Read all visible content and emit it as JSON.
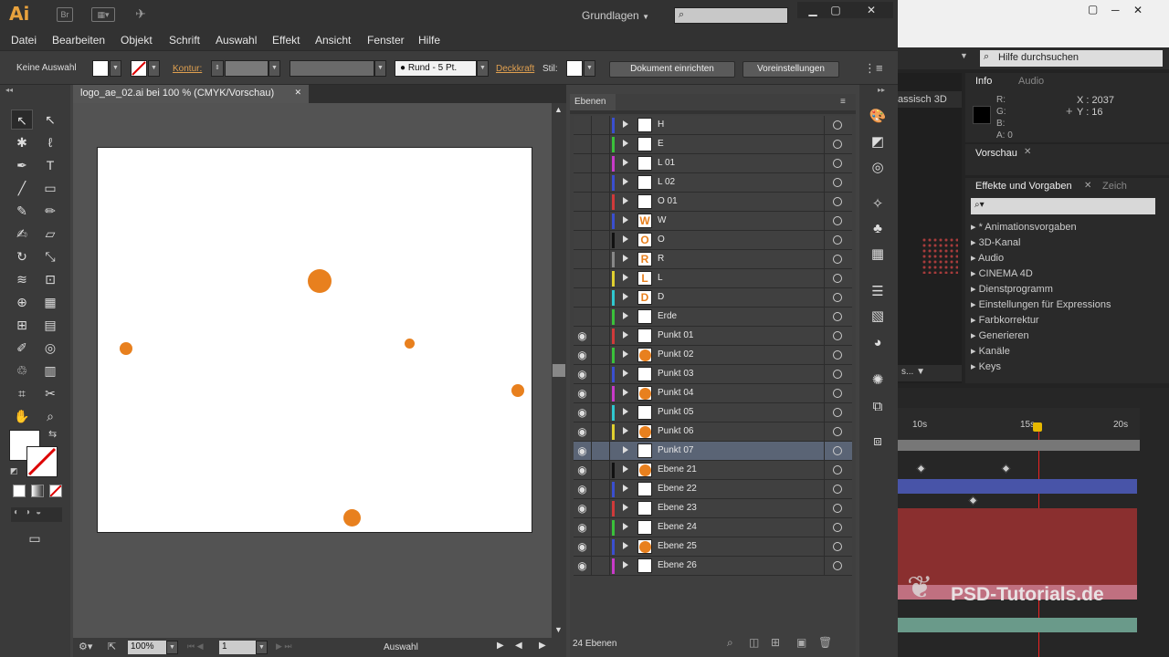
{
  "app": {
    "logo": "Ai",
    "workspace": "Grundlagen"
  },
  "menu": [
    "Datei",
    "Bearbeiten",
    "Objekt",
    "Schrift",
    "Auswahl",
    "Effekt",
    "Ansicht",
    "Fenster",
    "Hilfe"
  ],
  "control": {
    "selection": "Keine Auswahl",
    "kontur_label": "Kontur:",
    "brush": "Rund - 5 Pt.",
    "deckkraft_label": "Deckkraft",
    "stil_label": "Stil:",
    "doc_setup": "Dokument einrichten",
    "preferences": "Voreinstellungen"
  },
  "document": {
    "tab_title": "logo_ae_02.ai bei 100 % (CMYK/Vorschau)"
  },
  "status": {
    "zoom": "100%",
    "artboard": "1",
    "tool": "Auswahl"
  },
  "layers_panel": {
    "title": "Ebenen",
    "count": "24 Ebenen",
    "layers": [
      {
        "name": "H",
        "color": "#3a4fd0",
        "eye": false,
        "thumb": ""
      },
      {
        "name": "E",
        "color": "#3ac03a",
        "eye": false,
        "thumb": ""
      },
      {
        "name": "L 01",
        "color": "#c83ac8",
        "eye": false,
        "thumb": ""
      },
      {
        "name": "L 02",
        "color": "#3a4fd0",
        "eye": false,
        "thumb": ""
      },
      {
        "name": "O 01",
        "color": "#d03a3a",
        "eye": false,
        "thumb": ""
      },
      {
        "name": "W",
        "color": "#3a4fd0",
        "eye": false,
        "thumb": "W"
      },
      {
        "name": "O",
        "color": "#111111",
        "eye": false,
        "thumb": "O"
      },
      {
        "name": "R",
        "color": "#888888",
        "eye": false,
        "thumb": "R"
      },
      {
        "name": "L",
        "color": "#e0d030",
        "eye": false,
        "thumb": "L"
      },
      {
        "name": "D",
        "color": "#30c8d0",
        "eye": false,
        "thumb": "D"
      },
      {
        "name": "Erde",
        "color": "#3ac03a",
        "eye": false,
        "thumb": ""
      },
      {
        "name": "Punkt 01",
        "color": "#d03a3a",
        "eye": true,
        "thumb": ""
      },
      {
        "name": "Punkt 02",
        "color": "#3ac03a",
        "eye": true,
        "thumb": "dot"
      },
      {
        "name": "Punkt 03",
        "color": "#3a4fd0",
        "eye": true,
        "thumb": ""
      },
      {
        "name": "Punkt 04",
        "color": "#c83ac8",
        "eye": true,
        "thumb": "dot"
      },
      {
        "name": "Punkt 05",
        "color": "#30c8d0",
        "eye": true,
        "thumb": ""
      },
      {
        "name": "Punkt 06",
        "color": "#e0d030",
        "eye": true,
        "thumb": "dot"
      },
      {
        "name": "Punkt 07",
        "color": "#5a6475",
        "eye": true,
        "thumb": "",
        "selected": true
      },
      {
        "name": "Ebene 21",
        "color": "#111111",
        "eye": true,
        "thumb": "dot"
      },
      {
        "name": "Ebene 22",
        "color": "#3a4fd0",
        "eye": true,
        "thumb": ""
      },
      {
        "name": "Ebene 23",
        "color": "#d03a3a",
        "eye": true,
        "thumb": ""
      },
      {
        "name": "Ebene 24",
        "color": "#3ac03a",
        "eye": true,
        "thumb": ""
      },
      {
        "name": "Ebene 25",
        "color": "#3a4fd0",
        "eye": true,
        "thumb": "dot"
      },
      {
        "name": "Ebene 26",
        "color": "#c83ac8",
        "eye": true,
        "thumb": ""
      }
    ]
  },
  "ae": {
    "help_search": "Hilfe durchsuchen",
    "comp_label": "assisch 3D",
    "info_tab": "Info",
    "audio_tab": "Audio",
    "info_r": "R:",
    "info_g": "G:",
    "info_b": "B:",
    "info_a": "A:  0",
    "info_x": "X : 2037",
    "info_y": "Y : 16",
    "preview_tab": "Vorschau",
    "effects_tab": "Effekte und Vorgaben",
    "char_tab": "Zeich",
    "effects": [
      "* Animationsvorgaben",
      "3D-Kanal",
      "Audio",
      "CINEMA 4D",
      "Dienstprogramm",
      "Einstellungen für Expressions",
      "Farbkorrektur",
      "Generieren",
      "Kanäle",
      "Keys"
    ],
    "timeline_ticks": [
      "10s",
      "15s",
      "20s"
    ],
    "watermark": "PSD-Tutorials.de"
  }
}
